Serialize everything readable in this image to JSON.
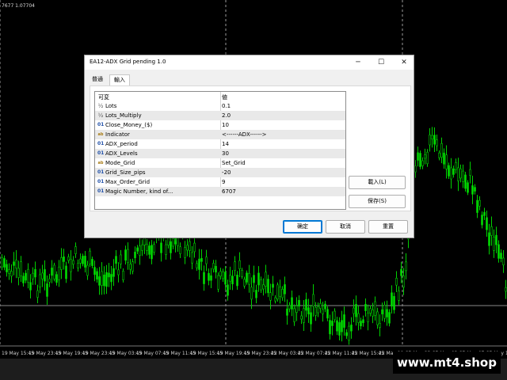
{
  "chart": {
    "top_info": "7677 1.07704",
    "time_labels": [
      "19 May 15:45",
      "19 May 23:45",
      "19 May 19:45",
      "19 May 23:45",
      "19 May 03:45",
      "19 May 07:45",
      "19 May 11:45",
      "19 May 15:45",
      "19 May 19:45",
      "19 May 23:45",
      "22 May 03:45",
      "22 May 07:45",
      "22 May 11:45",
      "22 May 15:45",
      "22 May 19:45",
      "22 May 23:45",
      "23 May 03:45",
      "23 May 07:45",
      "23 May 11:45"
    ]
  },
  "watermark": "www.mt4.shop",
  "dialog": {
    "title": "EA12-ADX Grid pending 1.0",
    "window_buttons": {
      "minimize": "─",
      "maximize": "☐",
      "close": "✕"
    },
    "tabs": [
      {
        "label": "普通",
        "active": false
      },
      {
        "label": "輸入",
        "active": true
      }
    ],
    "grid": {
      "col_variable": "可変",
      "col_value": "値",
      "rows": [
        {
          "icon": "½",
          "icon_name": "fraction-icon",
          "name": "Lots",
          "value": "0.1"
        },
        {
          "icon": "½",
          "icon_name": "fraction-icon",
          "name": "Lots_Multiply",
          "value": "2.0"
        },
        {
          "icon": "01",
          "icon_name": "integer-icon",
          "name": "Close_Money_($)",
          "value": "10"
        },
        {
          "icon": "ab",
          "icon_name": "string-icon",
          "name": "Indicator",
          "value": "<------ADX------>"
        },
        {
          "icon": "01",
          "icon_name": "integer-icon",
          "name": "ADX_period",
          "value": "14"
        },
        {
          "icon": "01",
          "icon_name": "integer-icon",
          "name": "ADX_Levels",
          "value": "30"
        },
        {
          "icon": "ab",
          "icon_name": "string-icon",
          "name": "Mode_Grid",
          "value": "Set_Grid"
        },
        {
          "icon": "01",
          "icon_name": "integer-icon",
          "name": "Grid_Size_pips",
          "value": "-20"
        },
        {
          "icon": "01",
          "icon_name": "integer-icon",
          "name": "Max_Order_Grid",
          "value": "9"
        },
        {
          "icon": "01",
          "icon_name": "integer-icon",
          "name": "Magic Number, kind of...",
          "value": "6707"
        }
      ]
    },
    "side_buttons": {
      "load": "載入(L)",
      "save": "保存(S)"
    },
    "footer_buttons": {
      "ok": "确定",
      "cancel": "取消",
      "reset": "重置"
    }
  },
  "colors": {
    "bull": "#00e000",
    "background": "#000000",
    "accent": "#0078d4"
  }
}
